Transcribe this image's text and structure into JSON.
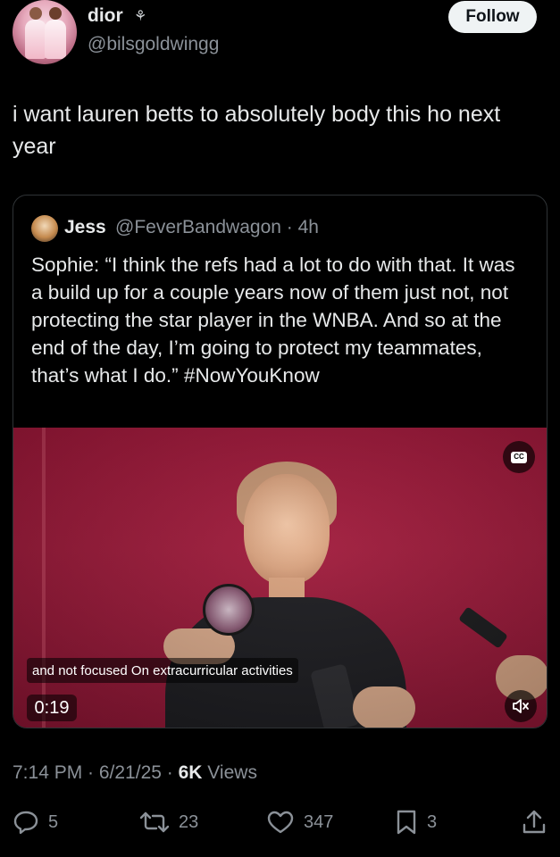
{
  "author": {
    "display_name": "dior",
    "name_emoji": "⚘",
    "handle": "@bilsgoldwingg",
    "follow_label": "Follow"
  },
  "tweet": {
    "text": "i want lauren betts to absolutely body this ho next year"
  },
  "quote": {
    "name": "Jess",
    "handle": "@FeverBandwagon",
    "time": "4h",
    "meta": "@FeverBandwagon · 4h",
    "text": "Sophie: “I think the refs had a lot to do with that. It was a build up for a couple years now of them just not, not protecting the star player in the WNBA. And so at the end of the day, I’m going to protect my teammates, that’s what I do.” #NowYouKnow",
    "video": {
      "caption": "and not focused On extracurricular activities",
      "timestamp": "0:19",
      "cc_label": "CC"
    }
  },
  "post_meta": {
    "time_date": "7:14 PM · 6/21/25 · ",
    "views_count": "6K",
    "views_label": " Views"
  },
  "actions": {
    "replies": "5",
    "reposts": "23",
    "likes": "347",
    "bookmarks": "3"
  },
  "colors": {
    "background": "#000000",
    "text_primary": "#e7e9ea",
    "text_secondary": "#8b9198",
    "border": "#2f3336",
    "follow_bg": "#eff3f4"
  }
}
